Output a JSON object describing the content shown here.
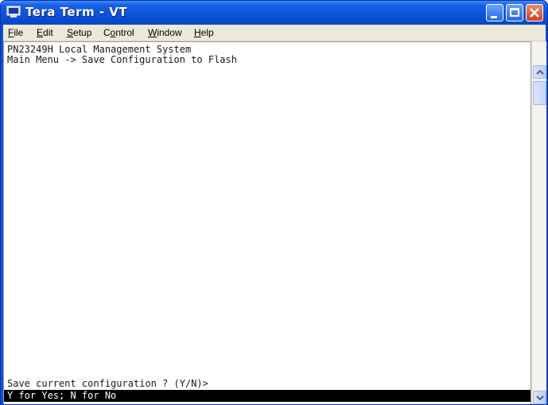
{
  "window": {
    "title": "Tera Term - VT",
    "controls": {
      "minimize": "minimize-icon",
      "maximize": "maximize-icon",
      "close": "close-icon"
    }
  },
  "menu": {
    "items": [
      {
        "label": "File",
        "underline": "F"
      },
      {
        "label": "Edit",
        "underline": "E"
      },
      {
        "label": "Setup",
        "underline": "S"
      },
      {
        "label": "Control",
        "underline": "o"
      },
      {
        "label": "Window",
        "underline": "W"
      },
      {
        "label": "Help",
        "underline": "H"
      }
    ]
  },
  "terminal": {
    "lines": [
      "PN23249H Local Management System",
      "Main Menu -> Save Configuration to Flash"
    ],
    "prompt": "Save current configuration ? (Y/N)>",
    "status": "Y for Yes; N for No"
  },
  "colors": {
    "titlebar": "#0a53d6",
    "menubar": "#ece9d8",
    "terminal_bg": "#ffffff",
    "status_bg": "#000000",
    "close_button": "#d1401c"
  }
}
